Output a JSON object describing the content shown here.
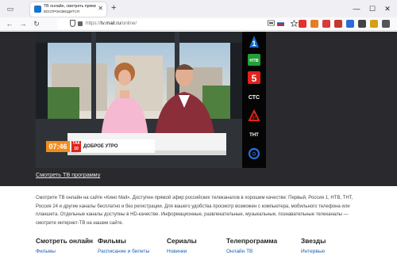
{
  "browser": {
    "tab": {
      "title": "ТВ онлайн, смотреть прямой",
      "subtitle": "ВОСПРОИЗВОДИТСЯ",
      "close": "✕"
    },
    "new_tab": "+",
    "window": {
      "minimize": "—",
      "maximize": "☐",
      "close": "✕"
    },
    "nav": {
      "back": "←",
      "forward": "→",
      "reload": "↻"
    },
    "url": {
      "prefix": "https://",
      "domain": "tv.mail.ru",
      "path": "/online/"
    }
  },
  "player": {
    "time": "07:46",
    "badge": "ТАК",
    "badge_sub": "10",
    "show_name": "ДОБРОЕ УТРО"
  },
  "channels": [
    {
      "name": "Первый",
      "label": "1",
      "color": "#1e6fd0"
    },
    {
      "name": "НТВ",
      "label": "НТВ",
      "color": "#21a036"
    },
    {
      "name": "Пятый канал",
      "label": "5",
      "color": "#e2231a"
    },
    {
      "name": "СТС",
      "label": "СТС",
      "color": "#ffffff"
    },
    {
      "name": "Рен ТВ",
      "label": "Р",
      "color": "#e2231a"
    },
    {
      "name": "ТНТ",
      "label": "ТНТ",
      "color": "#ffffff"
    },
    {
      "name": "Россия 24",
      "label": "О",
      "color": "#2a6fd6"
    }
  ],
  "program_link": "Смотреть ТВ программу",
  "description": "Смотрите ТВ онлайн на сайте «Кино Mail». Доступен прямой эфир российских телеканалов в хорошем качестве: Первый, Россия 1, НТВ, ТНТ, Россия 24 и другие каналы бесплатно и без регистрации. Для вашего удобства просмотр возможен с компьютера, мобильного телефона или планшета. Отдельные каналы доступны в HD-качестве. Информационные, развлекательные, музыкальные, познавательные телеканалы — смотрите интернет-ТВ на нашем сайте.",
  "footer_menu": [
    {
      "heading": "Смотреть онлайн",
      "link": "Фильмы"
    },
    {
      "heading": "Фильмы",
      "link": "Расписание и билеты"
    },
    {
      "heading": "Сериалы",
      "link": "Новинки"
    },
    {
      "heading": "Телепрограмма",
      "link": "Онлайн ТВ"
    },
    {
      "heading": "Звезды",
      "link": "Интервью"
    }
  ],
  "colors": {
    "link": "#1a5fb4",
    "chrome": "#f0f0f4",
    "dark_bg": "#2a2a2e",
    "accent_orange": "#f28c1b"
  }
}
